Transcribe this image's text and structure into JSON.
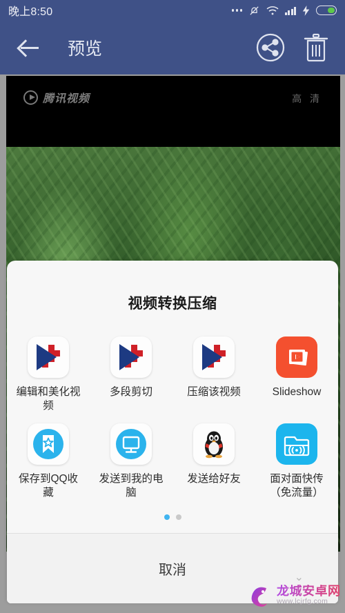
{
  "status_bar": {
    "time": "晚上8:50",
    "icons": [
      "more-dots-icon",
      "bell-muted-icon",
      "wifi-icon",
      "signal-bars-icon",
      "charging-bolt-icon",
      "battery-icon"
    ],
    "background_color": "#3f5187"
  },
  "app_bar": {
    "title": "预览",
    "back_icon": "back-arrow-icon",
    "share_icon": "share-nodes-icon",
    "delete_icon": "trash-icon",
    "background_color": "#3f5187"
  },
  "video": {
    "watermark_text": "腾讯视频",
    "quality_label": "高 清",
    "play_icon": "play-circle-icon"
  },
  "share_sheet": {
    "title": "视频转换压缩",
    "items": [
      {
        "label": "编辑和美化视频",
        "icon": "video-editor-icon",
        "icon_style": "editor"
      },
      {
        "label": "多段剪切",
        "icon": "video-editor-icon",
        "icon_style": "editor"
      },
      {
        "label": "压缩该视频",
        "icon": "video-editor-icon",
        "icon_style": "editor"
      },
      {
        "label": "Slideshow",
        "icon": "slideshow-icon",
        "icon_style": "slideshow"
      },
      {
        "label": "保存到QQ收藏",
        "icon": "bookmark-star-icon",
        "icon_style": "qqfav"
      },
      {
        "label": "发送到我的电脑",
        "icon": "monitor-icon",
        "icon_style": "computer"
      },
      {
        "label": "发送给好友",
        "icon": "qq-penguin-icon",
        "icon_style": "penguin"
      },
      {
        "label": "面对面快传（免流量）",
        "icon": "folder-broadcast-icon",
        "icon_style": "facetoface"
      }
    ],
    "pager": {
      "total": 2,
      "active": 1,
      "active_color": "#40b4f0",
      "inactive_color": "#c9c9c9"
    },
    "cancel_label": "取消"
  },
  "watermark": {
    "site_name": "龙城安卓网",
    "site_url": "www.lcjrfg.com",
    "logo_icon": "dragon-logo-icon"
  }
}
